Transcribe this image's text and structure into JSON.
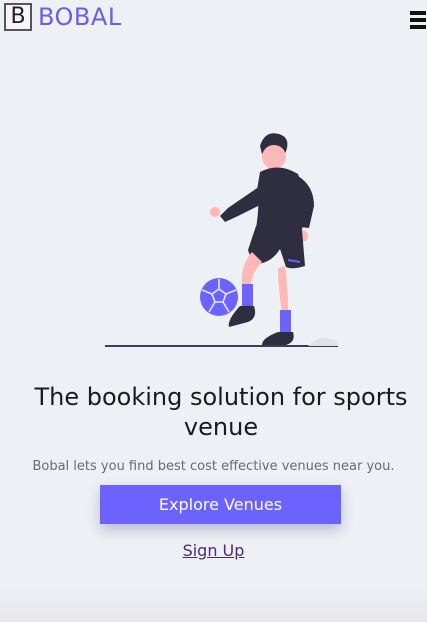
{
  "nav": {
    "logo_letter": "B",
    "brand": "BOBAL",
    "menu_icon": "hamburger-menu-icon"
  },
  "hero": {
    "illustration": "soccer-player-juggling-ball",
    "ball_color": "#6c63ff"
  },
  "main": {
    "headline": "The booking solution for sports venue",
    "description": "Bobal lets you find best cost effective venues near you.",
    "explore_label": "Explore Venues",
    "signup_label": "Sign Up"
  },
  "colors": {
    "accent": "#6c63ff",
    "background": "#edf0f4"
  }
}
